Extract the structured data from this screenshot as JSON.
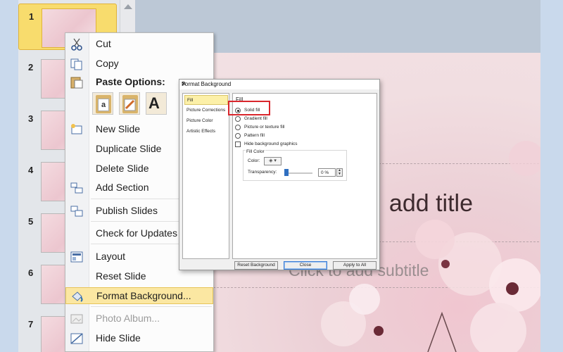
{
  "thumbnails": [
    {
      "num": "1",
      "selected": true
    },
    {
      "num": "2"
    },
    {
      "num": "3"
    },
    {
      "num": "4"
    },
    {
      "num": "5"
    },
    {
      "num": "6"
    },
    {
      "num": "7"
    }
  ],
  "slide": {
    "title_placeholder": "add title",
    "subtitle_placeholder": "Click to add subtitle"
  },
  "context_menu": {
    "cut": "Cut",
    "copy": "Copy",
    "paste_options": "Paste Options:",
    "new_slide": "New Slide",
    "duplicate_slide": "Duplicate Slide",
    "delete_slide": "Delete Slide",
    "add_section": "Add Section",
    "publish_slides": "Publish Slides",
    "check_updates": "Check for Updates",
    "layout": "Layout",
    "reset_slide": "Reset Slide",
    "format_background": "Format Background...",
    "photo_album": "Photo Album...",
    "hide_slide": "Hide Slide",
    "paste_icons": [
      "paste-use-destination-theme-icon",
      "paste-keep-source-formatting-icon",
      "paste-keep-text-only-icon"
    ],
    "paste_text_glyph": "A",
    "paste_a_glyph": "a"
  },
  "dialog": {
    "title": "Format Background",
    "help": "?",
    "close": "✕",
    "nav": [
      "Fill",
      "Picture Corrections",
      "Picture Color",
      "Artistic Effects"
    ],
    "fill_heading": "Fill",
    "options": [
      "Solid fill",
      "Gradient fill",
      "Picture or texture fill",
      "Pattern fill"
    ],
    "hide_graphics": "Hide background graphics",
    "fill_color_group": "Fill Color",
    "color_label": "Color:",
    "transparency_label": "Transparency:",
    "transparency_value": "0 %",
    "buttons": {
      "reset": "Reset Background",
      "close": "Close",
      "apply_all": "Apply to All"
    }
  },
  "colors": {
    "highlight": "#fbe7a2",
    "selected_thumb": "#f8dc6d",
    "annotation_red": "#d9262c"
  }
}
